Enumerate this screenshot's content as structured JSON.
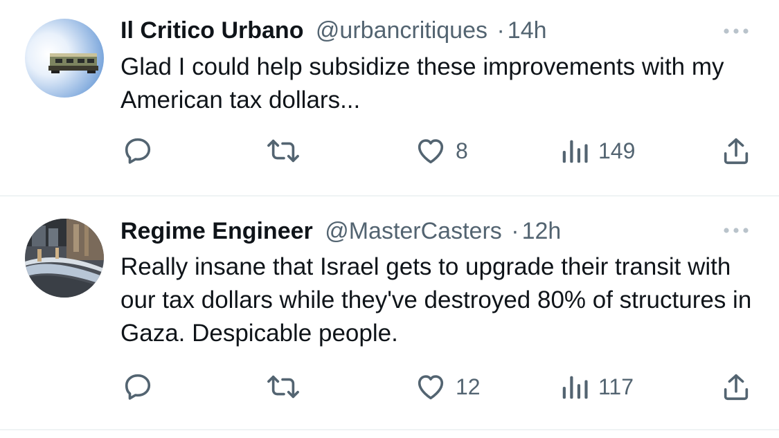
{
  "tweets": [
    {
      "display_name": "Il Critico Urbano",
      "handle": "@urbancritiques",
      "separator": "·",
      "time": "14h",
      "text": "Glad I could help subsidize these improvements with my American tax dollars...",
      "actions": {
        "reply_count": "",
        "retweet_count": "",
        "like_count": "8",
        "view_count": "149"
      },
      "icons": {
        "reply": "reply-icon",
        "retweet": "retweet-icon",
        "like": "heart-icon",
        "views": "views-icon",
        "share": "share-icon",
        "more": "more-icon"
      }
    },
    {
      "display_name": "Regime Engineer",
      "handle": "@MasterCasters",
      "separator": "·",
      "time": "12h",
      "text": "Really insane that Israel gets to upgrade their transit with our tax dollars while they've destroyed 80% of structures in Gaza. Despicable people.",
      "actions": {
        "reply_count": "",
        "retweet_count": "",
        "like_count": "12",
        "view_count": "117"
      },
      "icons": {
        "reply": "reply-icon",
        "retweet": "retweet-icon",
        "like": "heart-icon",
        "views": "views-icon",
        "share": "share-icon",
        "more": "more-icon"
      }
    }
  ],
  "colors": {
    "text_primary": "#0f1419",
    "text_secondary": "#536471",
    "divider": "#eff3f4"
  }
}
